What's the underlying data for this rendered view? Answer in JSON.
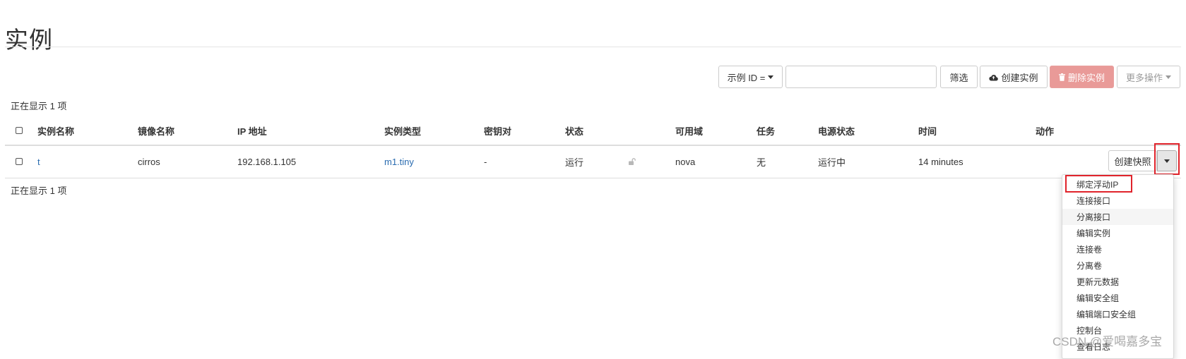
{
  "page": {
    "title": "实例"
  },
  "toolbar": {
    "filter_field_label": "示例 ID =",
    "filter_value": "",
    "filter_button": "筛选",
    "create_button": "创建实例",
    "delete_button": "删除实例",
    "more_button": "更多操作"
  },
  "summary": {
    "top": "正在显示 1 项",
    "bottom": "正在显示 1 项"
  },
  "table": {
    "headers": {
      "name": "实例名称",
      "image": "镜像名称",
      "ip": "IP 地址",
      "flavor": "实例类型",
      "keypair": "密钥对",
      "status": "状态",
      "zone": "可用域",
      "task": "任务",
      "power": "电源状态",
      "age": "时间",
      "actions": "动作"
    },
    "rows": [
      {
        "name": "t",
        "image": "cirros",
        "ip": "192.168.1.105",
        "flavor": "m1.tiny",
        "keypair": "-",
        "status": "运行",
        "zone": "nova",
        "task": "无",
        "power": "运行中",
        "age": "14 minutes",
        "action_button": "创建快照"
      }
    ]
  },
  "action_menu": {
    "items": [
      "绑定浮动IP",
      "连接接口",
      "分离接口",
      "编辑实例",
      "连接卷",
      "分离卷",
      "更新元数据",
      "编辑安全组",
      "编辑端口安全组",
      "控制台",
      "查看日志"
    ],
    "hovered_index": 2
  },
  "watermark": "CSDN @爱喝嘉多宝",
  "colors": {
    "link": "#2a6cb0",
    "danger_button": "#e99a98",
    "annotation_red": "#e0232b"
  }
}
